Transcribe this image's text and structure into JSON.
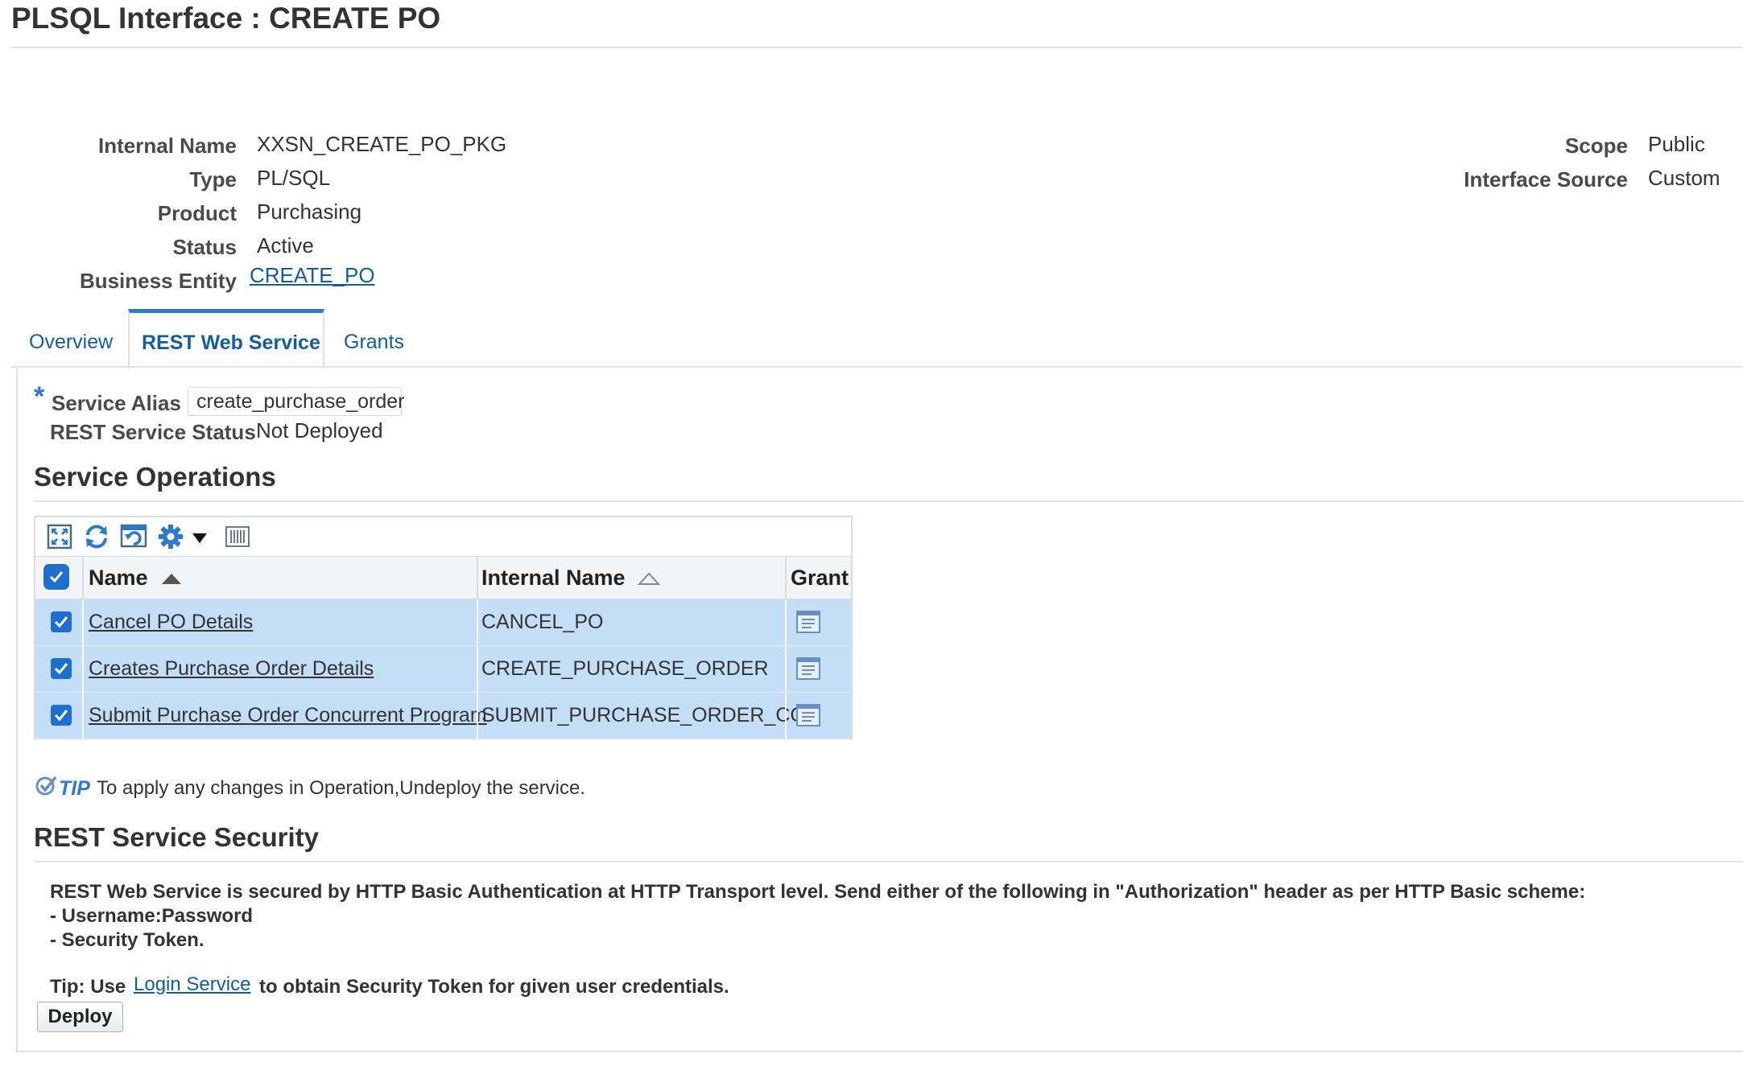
{
  "page": {
    "title": "PLSQL Interface : CREATE PO"
  },
  "details": {
    "left": [
      {
        "label": "Internal Name",
        "value": "XXSN_CREATE_PO_PKG"
      },
      {
        "label": "Type",
        "value": "PL/SQL"
      },
      {
        "label": "Product",
        "value": "Purchasing"
      },
      {
        "label": "Status",
        "value": "Active"
      },
      {
        "label": "Business Entity",
        "value": "CREATE_PO"
      }
    ],
    "right": [
      {
        "label": "Scope",
        "value": "Public"
      },
      {
        "label": "Interface Source",
        "value": "Custom"
      }
    ]
  },
  "tabs": [
    {
      "label": "Overview",
      "active": false
    },
    {
      "label": "REST Web Service",
      "active": true
    },
    {
      "label": "Grants",
      "active": false
    }
  ],
  "rest": {
    "required_marker": "*",
    "service_alias_label": "Service Alias",
    "service_alias_value": "create_purchase_order",
    "status_label": "REST Service Status",
    "status_value": "Not Deployed"
  },
  "operations": {
    "heading": "Service Operations",
    "toolbar_icons": [
      "detach-icon",
      "refresh-icon",
      "reset-icon",
      "gear-icon",
      "chevron-down-icon",
      "columns-icon"
    ],
    "columns": [
      "Name",
      "Internal Name",
      "Grant"
    ],
    "rows": [
      {
        "name": "Cancel PO Details",
        "internal_name": "CANCEL_PO",
        "checked": true
      },
      {
        "name": "Creates Purchase Order Details",
        "internal_name": "CREATE_PURCHASE_ORDER",
        "checked": true
      },
      {
        "name": "Submit Purchase Order Concurrent Program",
        "internal_name": "SUBMIT_PURCHASE_ORDER_CC",
        "checked": true
      }
    ]
  },
  "tip": {
    "badge": "TIP",
    "text": "To apply any changes in Operation,Undeploy the service."
  },
  "security": {
    "heading": "REST Service Security",
    "line1": "REST Web Service is secured by HTTP Basic Authentication at HTTP Transport level. Send either of the following in \"Authorization\" header as per HTTP Basic scheme:",
    "line2": "- Username:Password",
    "line3": "- Security Token.",
    "tip_prefix": "Tip: Use",
    "tip_link": "Login Service",
    "tip_suffix": "to obtain Security Token for given user credentials."
  },
  "actions": {
    "deploy_label": "Deploy"
  },
  "colors": {
    "accent": "#2c7acd",
    "link": "#145c9e",
    "row_selected": "#c4def7",
    "checkbox": "#1f6fcf"
  }
}
